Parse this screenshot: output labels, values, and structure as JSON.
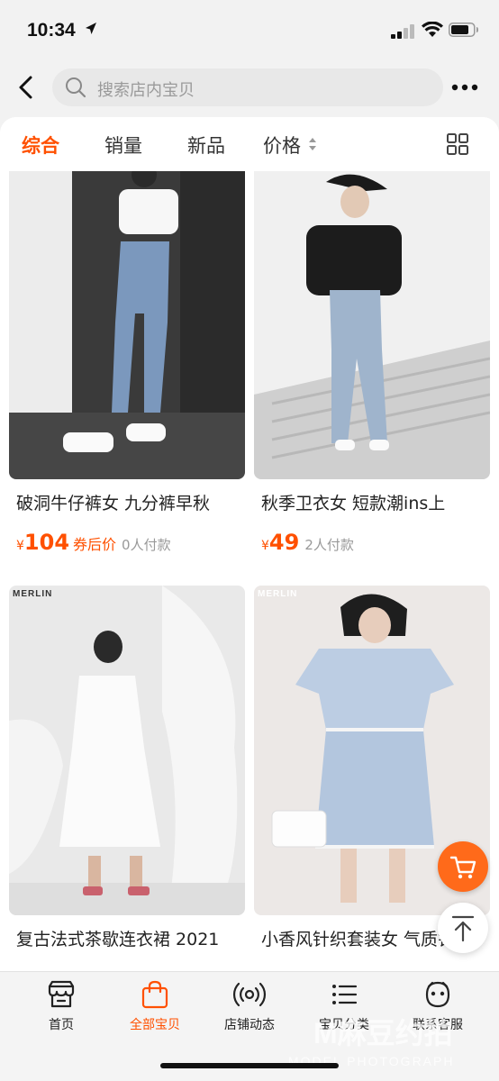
{
  "status_bar": {
    "time": "10:34",
    "icons": [
      "location-arrow-icon",
      "signal-icon",
      "wifi-icon",
      "battery-icon"
    ]
  },
  "nav": {
    "back_icon": "chevron-left-icon",
    "search_placeholder": "搜索店内宝贝",
    "more_icon": "more-dots-icon"
  },
  "tabs": [
    {
      "label": "综合",
      "active": true
    },
    {
      "label": "销量",
      "active": false
    },
    {
      "label": "新品",
      "active": false
    },
    {
      "label": "价格",
      "active": false,
      "icon": "sort-arrows-icon"
    }
  ],
  "layout_toggle_icon": "grid-view-icon",
  "products": [
    {
      "title": "破洞牛仔裤女 九分裤早秋",
      "currency": "¥",
      "price": "104",
      "price_tag": "券后价",
      "paid": "0人付款"
    },
    {
      "title": "秋季卫衣女 短款潮ins上",
      "currency": "¥",
      "price": "49",
      "price_tag": "",
      "paid": "2人付款"
    },
    {
      "title": "复古法式茶歇连衣裙 2021",
      "brand": "MERLIN"
    },
    {
      "title": "小香风针织套装女 气质针",
      "brand": "MERLIN"
    }
  ],
  "fabs": {
    "cart_icon": "cart-icon",
    "top_icon": "back-to-top-icon"
  },
  "tabbar": [
    {
      "label": "首页",
      "icon": "storefront-icon",
      "active": false
    },
    {
      "label": "全部宝贝",
      "icon": "shopping-bag-icon",
      "active": true
    },
    {
      "label": "店铺动态",
      "icon": "broadcast-icon",
      "active": false
    },
    {
      "label": "宝贝分类",
      "icon": "list-icon",
      "active": false
    },
    {
      "label": "联系客服",
      "icon": "service-face-icon",
      "active": false
    }
  ],
  "watermark": {
    "main": "M麻豆约拍",
    "sub": "MODEL PHOTOGRAPH"
  },
  "colors": {
    "accent": "#ff5000",
    "background": "#f2f2f2"
  }
}
